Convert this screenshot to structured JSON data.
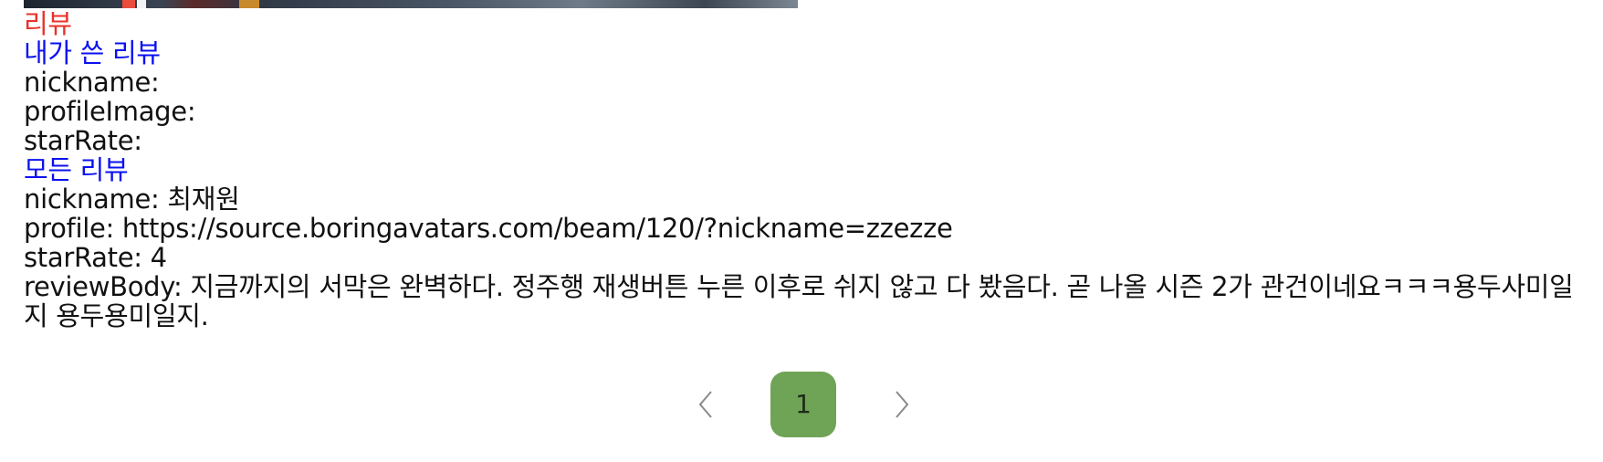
{
  "review_section": {
    "title": "리뷰",
    "my_reviews": {
      "heading": "내가 쓴 리뷰",
      "nickname_label": "nickname:",
      "profile_image_label": "profileImage:",
      "star_rate_label": "starRate:"
    },
    "all_reviews": {
      "heading": "모든 리뷰",
      "items": [
        {
          "nickname": "nickname: 최재원",
          "profile": "profile: https://source.boringavatars.com/beam/120/?nickname=zzezze",
          "star_rate": "starRate: 4",
          "review_body": "reviewBody: 지금까지의 서막은 완벽하다. 정주행 재생버튼 누른 이후로 쉬지 않고 다 봤음다. 곧 나올 시즌 2가 관건이네요ㅋㅋㅋ용두사미일지 용두용미일지."
        }
      ]
    }
  },
  "pagination": {
    "current_page": "1",
    "prev_icon": "chevron-left-icon",
    "next_icon": "chevron-right-icon",
    "accent_color": "#6fa356"
  },
  "colors": {
    "section_title": "#e8322a",
    "subheading": "#0b10f0"
  }
}
